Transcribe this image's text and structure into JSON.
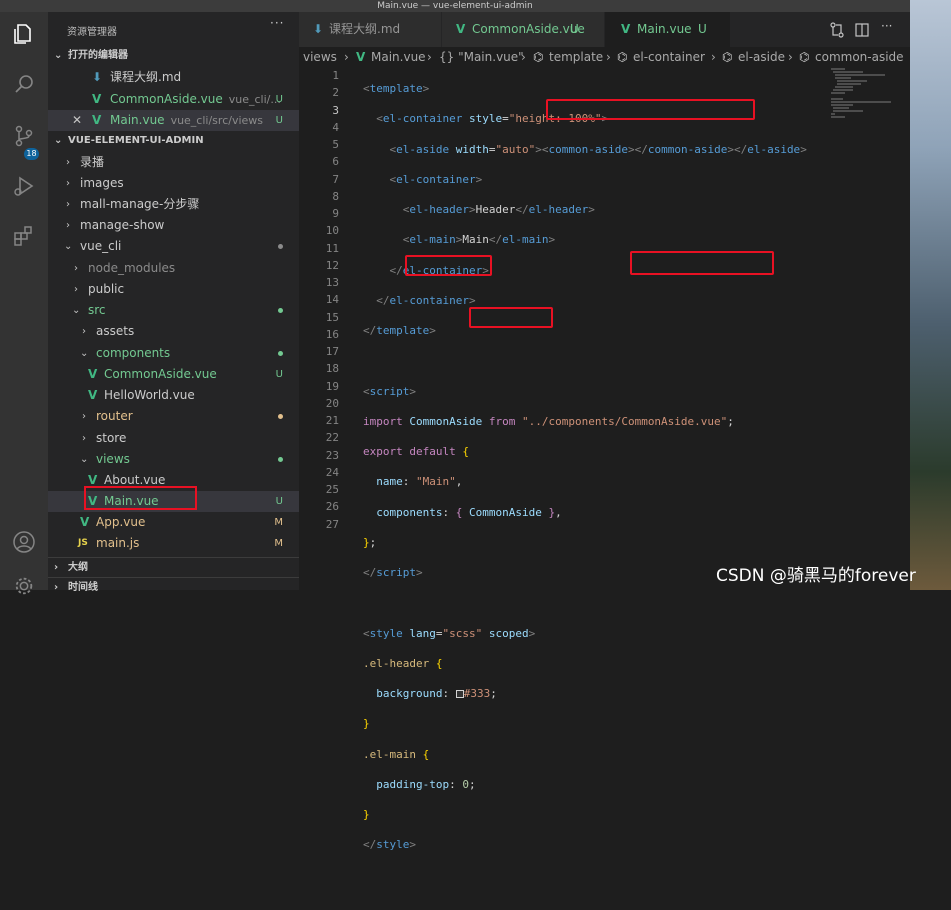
{
  "window": {
    "title": "Main.vue — vue-element-ui-admin"
  },
  "activity": {
    "scm_badge": "18"
  },
  "sidebar": {
    "title": "资源管理器",
    "open_editors": {
      "header": "打开的编辑器",
      "items": [
        {
          "name": "课程大纲.md",
          "desc": "",
          "status": ""
        },
        {
          "name": "CommonAside.vue",
          "desc": "vue_cli/...",
          "status": "U"
        },
        {
          "name": "Main.vue",
          "desc": "vue_cli/src/views",
          "status": "U"
        }
      ]
    },
    "workspace": {
      "header": "VUE-ELEMENT-UI-ADMIN"
    },
    "tree": [
      {
        "name": "录播",
        "status": ""
      },
      {
        "name": "images",
        "status": ""
      },
      {
        "name": "mall-manage-分步骤",
        "status": ""
      },
      {
        "name": "manage-show",
        "status": ""
      },
      {
        "name": "vue_cli",
        "status": ""
      },
      {
        "name": "node_modules",
        "status": ""
      },
      {
        "name": "public",
        "status": ""
      },
      {
        "name": "src",
        "status": ""
      },
      {
        "name": "assets",
        "status": ""
      },
      {
        "name": "components",
        "status": ""
      },
      {
        "name": "CommonAside.vue",
        "status": "U"
      },
      {
        "name": "HelloWorld.vue",
        "status": ""
      },
      {
        "name": "router",
        "status": ""
      },
      {
        "name": "store",
        "status": ""
      },
      {
        "name": "views",
        "status": ""
      },
      {
        "name": "About.vue",
        "status": ""
      },
      {
        "name": "Main.vue",
        "status": "U"
      },
      {
        "name": "App.vue",
        "status": "M"
      },
      {
        "name": "main.js",
        "status": "M"
      }
    ],
    "outline": "大纲",
    "timeline": "时间线"
  },
  "tabs": [
    {
      "label": "课程大纲.md",
      "status": ""
    },
    {
      "label": "CommonAside.vue",
      "status": "U"
    },
    {
      "label": "Main.vue",
      "status": "U"
    }
  ],
  "breadcrumb": [
    "views",
    "Main.vue",
    "{} \"Main.vue\"",
    "template",
    "el-container",
    "el-aside",
    "common-aside"
  ],
  "line_numbers": [
    "1",
    "2",
    "3",
    "4",
    "5",
    "6",
    "7",
    "8",
    "9",
    "10",
    "11",
    "12",
    "13",
    "14",
    "15",
    "16",
    "17",
    "18",
    "19",
    "20",
    "21",
    "22",
    "23",
    "24",
    "25",
    "26",
    "27"
  ],
  "colors": {
    "vue": "#41b883",
    "untracked": "#73c991",
    "modified": "#e2c08d",
    "highlight": "#e81123"
  },
  "watermark": "CSDN @骑黑马的forever"
}
